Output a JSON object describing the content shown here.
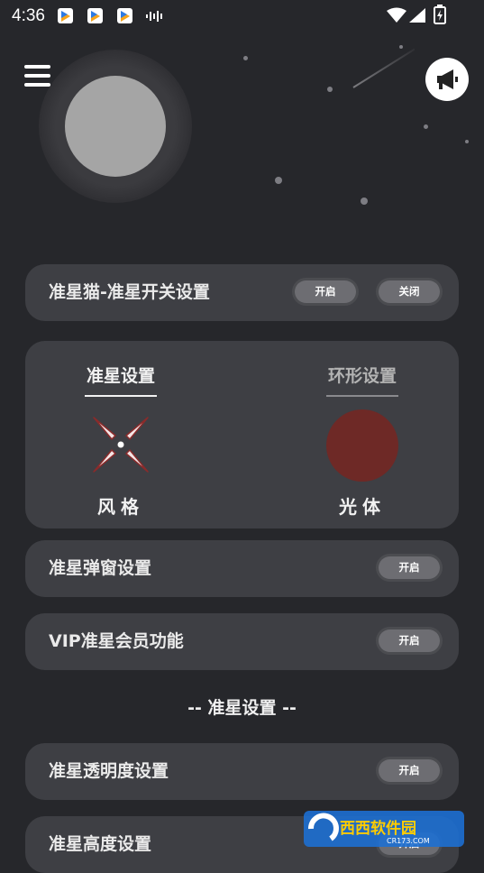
{
  "status_bar": {
    "time": "4:36",
    "icons": [
      "app-badge-icon",
      "app-badge-icon",
      "app-badge-icon",
      "sound-wave-icon",
      "wifi-icon",
      "signal-icon",
      "battery-charging-icon"
    ]
  },
  "header": {
    "menu_icon": "hamburger-menu-icon",
    "announce_icon": "megaphone-icon"
  },
  "switch_row": {
    "label": "准星猫-准星开关设置",
    "on_label": "开启",
    "off_label": "关闭"
  },
  "style_card": {
    "tab_crosshair": "准星设置",
    "tab_ring": "环形设置",
    "style_caption": "风格",
    "body_caption": "光体",
    "ring_color": "#6e2926",
    "active_tab_color": "#f2f2f2",
    "inactive_tab_color": "#b3b3b3"
  },
  "popup_row": {
    "label": "准星弹窗设置",
    "button_label": "开启"
  },
  "vip_row": {
    "label": "VIP准星会员功能",
    "button_label": "开启"
  },
  "section_title": "-- 准星设置 --",
  "opacity_row": {
    "label": "准星透明度设置",
    "button_label": "开启"
  },
  "height_row": {
    "label": "准星高度设置",
    "button_label": "开启"
  },
  "watermark": {
    "brand": "西西软件园",
    "url": "CR173.COM"
  }
}
